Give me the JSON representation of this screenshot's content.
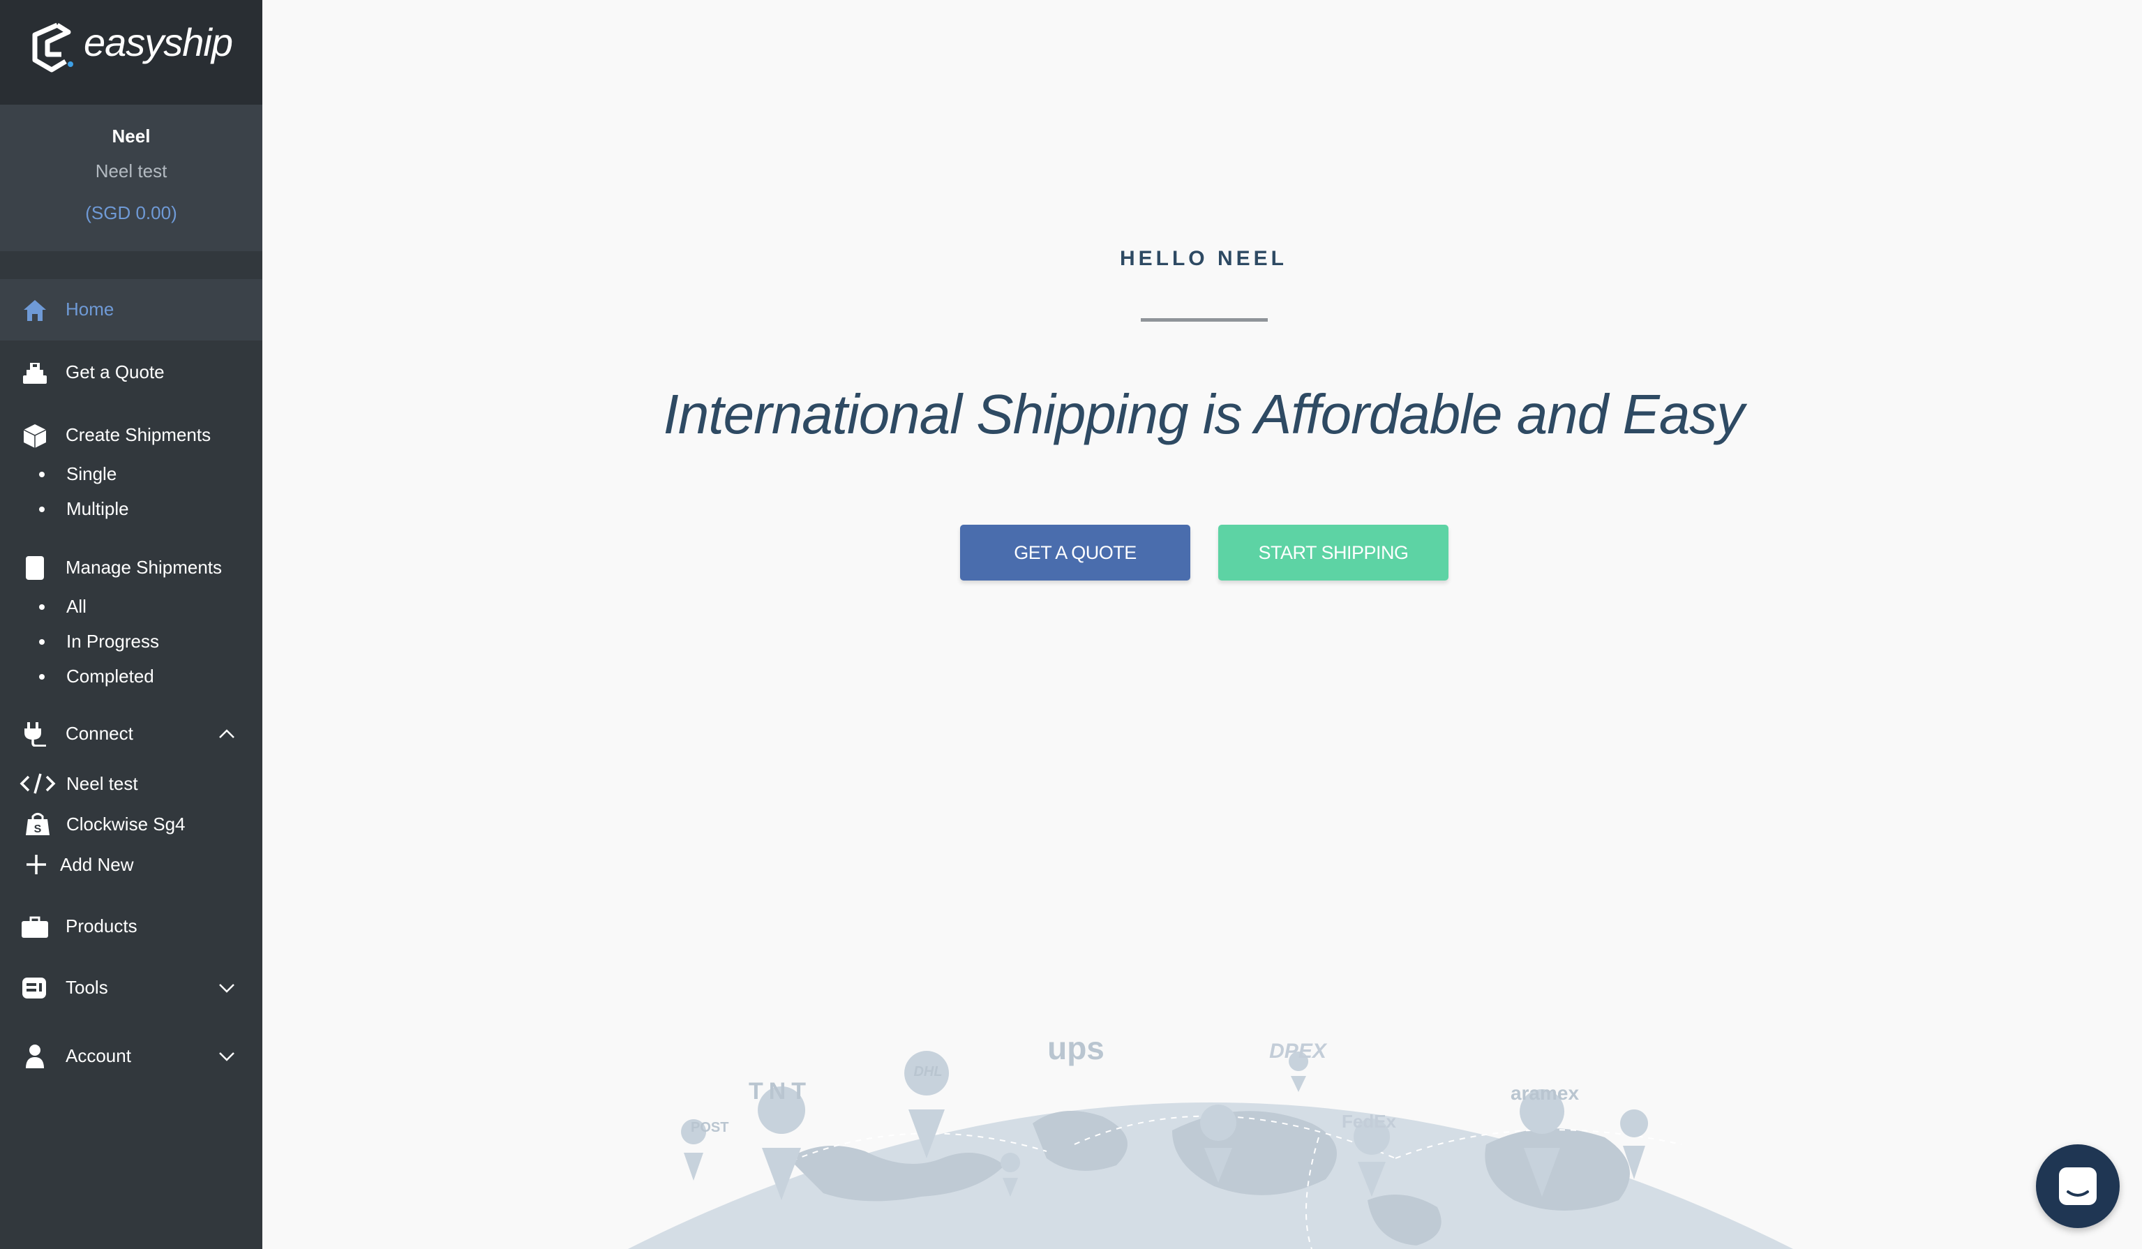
{
  "brand": {
    "name": "easyship"
  },
  "user": {
    "name": "Neel",
    "company": "Neel test",
    "balance": "(SGD 0.00)"
  },
  "sidebar": {
    "nav": [
      {
        "label": "Home",
        "icon": "home-icon",
        "active": true
      },
      {
        "label": "Get a Quote",
        "icon": "scale-icon"
      },
      {
        "label": "Create Shipments",
        "icon": "box-icon",
        "subitems": [
          "Single",
          "Multiple"
        ]
      },
      {
        "label": "Manage Shipments",
        "icon": "document-icon",
        "subitems": [
          "All",
          "In Progress",
          "Completed"
        ]
      },
      {
        "label": "Connect",
        "icon": "plug-icon",
        "chevron": "up"
      },
      {
        "label": "Products",
        "icon": "briefcase-icon"
      },
      {
        "label": "Tools",
        "icon": "tools-icon",
        "chevron": "down"
      },
      {
        "label": "Account",
        "icon": "user-icon",
        "chevron": "down"
      }
    ],
    "connect": [
      {
        "label": "Neel test",
        "icon": "code-icon"
      },
      {
        "label": "Clockwise Sg4",
        "icon": "shopify-bag-icon"
      },
      {
        "label": "Add New",
        "icon": "plus-icon"
      }
    ]
  },
  "main": {
    "greeting": "HELLO NEEL",
    "headline": "International Shipping is Affordable and Easy",
    "buttons": {
      "quote": "GET A QUOTE",
      "ship": "START SHIPPING"
    },
    "couriers": [
      "POST",
      "TNT",
      "DHL",
      "ups",
      "DPEX",
      "FedEx",
      "aramex"
    ]
  },
  "colors": {
    "sidebar": "#32383d",
    "active_link": "#6f9ad6",
    "quote_button": "#4a6dad",
    "ship_button": "#5dd3a4",
    "heading": "#2e4a63",
    "chat": "#1f3653"
  }
}
